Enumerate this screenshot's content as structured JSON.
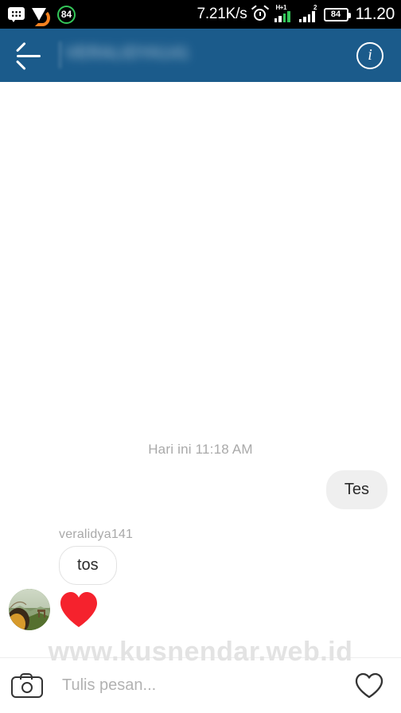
{
  "status_bar": {
    "icons_left": [
      {
        "name": "bbm-icon",
        "label": "BBM"
      },
      {
        "name": "mail-icon",
        "label": "Mail"
      },
      {
        "name": "battery-saver-icon",
        "label": "84"
      }
    ],
    "network_speed": "7.21K/s",
    "alarm_icon": "alarm-icon",
    "data_type": "H+1",
    "signal_badge": "2",
    "battery_percent": "84",
    "clock": "11.20"
  },
  "app_bar": {
    "back_icon": "back-arrow-icon",
    "title": "VERALIDYA141",
    "title_blurred": true,
    "info_icon": "info-icon",
    "background_color": "#1b5b8b"
  },
  "conversation": {
    "day_separator": "Hari ini 11:18 AM",
    "messages": [
      {
        "direction": "outgoing",
        "text": "Tes",
        "type": "text"
      },
      {
        "direction": "incoming",
        "sender": "veralidya141",
        "text": "tos",
        "type": "text"
      },
      {
        "direction": "incoming",
        "sender": "veralidya141",
        "text": "",
        "type": "heart-sticker",
        "color": "#f5222d"
      }
    ]
  },
  "watermark": {
    "text": "www.kusnendar.web.id"
  },
  "input_bar": {
    "camera_icon": "camera-icon",
    "placeholder": "Tulis pesan...",
    "value": "",
    "like_icon": "heart-icon"
  }
}
